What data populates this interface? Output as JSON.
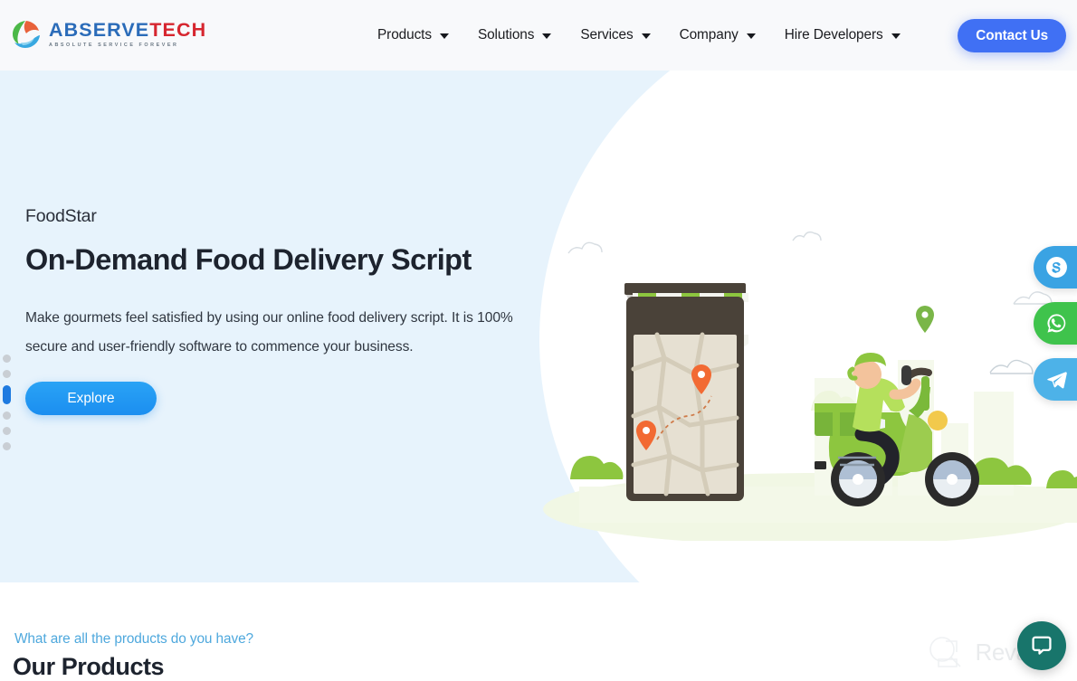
{
  "brand": {
    "name_part1": "ABSERVE",
    "name_part2": "TECH",
    "tagline": "ABSOLUTE SERVICE FOREVER",
    "color_primary": "#2b6cb9",
    "color_secondary": "#d6262f"
  },
  "header": {
    "nav_items": [
      {
        "label": "Products",
        "has_dropdown": true
      },
      {
        "label": "Solutions",
        "has_dropdown": true
      },
      {
        "label": "Services",
        "has_dropdown": true
      },
      {
        "label": "Company",
        "has_dropdown": true
      },
      {
        "label": "Hire Developers",
        "has_dropdown": true
      }
    ],
    "cta_label": "Contact Us",
    "cta_color": "#4070f4",
    "background": "#f8f9fb"
  },
  "hero": {
    "background": "#e7f3fc",
    "eyebrow": "FoodStar",
    "title": "On-Demand Food Delivery Script",
    "paragraph": "Make gourmets feel satisfied by using our online food delivery script. It is 100% secure and user-friendly software to commence your business.",
    "button_label": "Explore",
    "button_color": "#1e8cec",
    "carousel": {
      "total_slides": 6,
      "active_index": 3
    },
    "illustration": {
      "alt": "Food delivery rider on green scooter beside a smartphone showing a map with two location pins under a striped shop awning",
      "scooter_color": "#8cc63f",
      "pin_color": "#f26a33"
    }
  },
  "social_rail": [
    {
      "name": "Skype",
      "icon": "skype-icon",
      "color": "#3aa3e3"
    },
    {
      "name": "WhatsApp",
      "icon": "whatsapp-icon",
      "color": "#3fc34c"
    },
    {
      "name": "Telegram",
      "icon": "telegram-icon",
      "color": "#4db2e8"
    }
  ],
  "products_section": {
    "eyebrow": "What are all the products do you have?",
    "eyebrow_color": "#4ea8dd",
    "title": "Our Products"
  },
  "overlays": {
    "watermark_text": "Revain",
    "chat_button_color": "#18756b",
    "chat_icon": "chat-bubble-icon"
  }
}
